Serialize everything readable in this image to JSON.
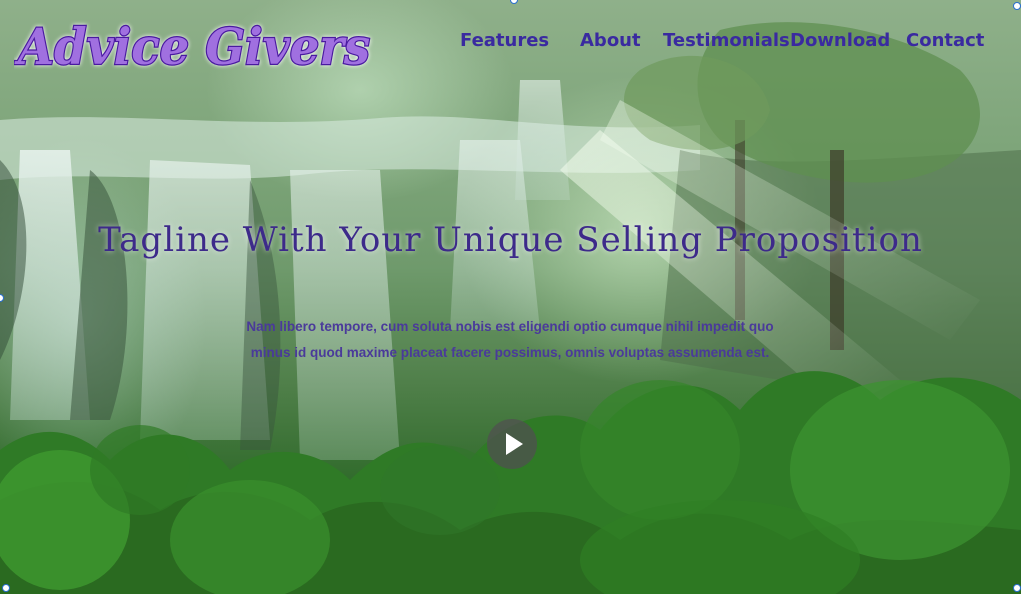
{
  "brand": {
    "logo_text": "Advice Givers"
  },
  "nav": {
    "items": [
      {
        "label": "Features"
      },
      {
        "label": "About"
      },
      {
        "label": "Testimonials"
      },
      {
        "label": "Download"
      },
      {
        "label": "Contact"
      }
    ]
  },
  "hero": {
    "tagline": "Tagline With Your Unique Selling Proposition",
    "description_line1": "Nam libero tempore, cum soluta nobis est eligendi optio cumque nihil impedit quo",
    "description_line2": "minus id quod maxime placeat facere possimus, omnis voluptas assumenda est."
  },
  "play_button": {
    "icon": "play-icon"
  },
  "colors": {
    "nav_text": "#3a2aa0",
    "tagline_text": "#3d2a8a",
    "logo_fill": "#a070e0",
    "logo_stroke": "#4a1aa0"
  }
}
